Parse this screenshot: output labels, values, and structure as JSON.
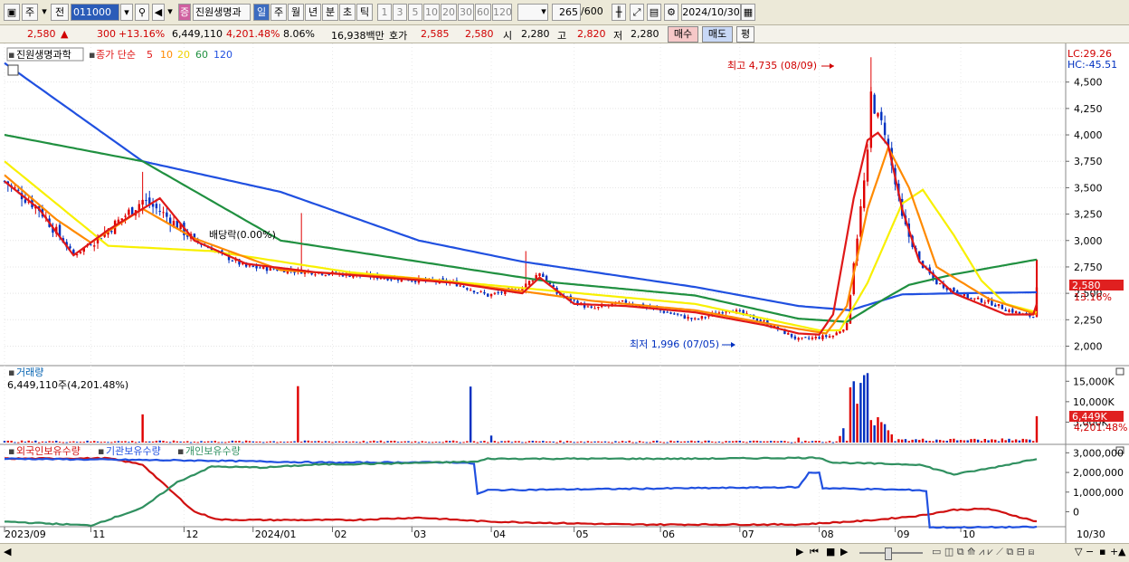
{
  "toolbar": {
    "market_sel": "주",
    "prev_label": "전",
    "stock_code": "011000",
    "stock_name": "진원생명과",
    "period_tabs": [
      "일",
      "주",
      "월",
      "년",
      "분",
      "초",
      "틱"
    ],
    "period_numbers": [
      "1",
      "3",
      "5",
      "10",
      "20",
      "30",
      "60",
      "120"
    ],
    "count": "265",
    "count_max": "/600",
    "date": "2024/10/30"
  },
  "quote": {
    "price": "2,580",
    "change_arrow": "▲",
    "change": "300",
    "change_pct": "+13.16%",
    "volume": "6,449,110",
    "vol_ratio": "4,201.48%",
    "turnover": "8.06%",
    "amount": "16,938백만",
    "hoga_label": "호가",
    "ask": "2,585",
    "bid": "2,580",
    "open_label": "시",
    "open": "2,280",
    "high_label": "고",
    "high": "2,820",
    "low_label": "저",
    "low": "2,280",
    "buy_label": "매수",
    "sell_label": "매도",
    "extra_label": "평"
  },
  "colors": {
    "ma5": "#e01818",
    "ma10": "#ff8a00",
    "ma20": "#f8f000",
    "ma60": "#209040",
    "ma120": "#2050e0",
    "up": "#e00000",
    "down": "#0030c0"
  },
  "chart_data": [
    {
      "type": "line",
      "panel": "price",
      "title": "진원생명과학",
      "legend": [
        "종가 단순",
        "5",
        "10",
        "20",
        "60",
        "120"
      ],
      "indicators": {
        "lc": "LC:29.26",
        "hc": "HC:-45.51"
      },
      "y_ticks": [
        "4,500",
        "4,250",
        "4,000",
        "3,750",
        "3,500",
        "3,250",
        "3,000",
        "2,750",
        "2,500",
        "2,250",
        "2,000"
      ],
      "ylim": [
        1850,
        4780
      ],
      "x_ticks": [
        "2023/09",
        "11",
        "12",
        "2024/01",
        "02",
        "03",
        "04",
        "05",
        "06",
        "07",
        "08",
        "09",
        "10",
        "10/30"
      ],
      "annotations": {
        "high": "최고 4,735 (08/09)",
        "low": "최저 1,996 (07/05)",
        "dividend": "배당락(0.00%)"
      },
      "last_price_label": "2,580",
      "last_change_label": "13.16%",
      "series": [
        {
          "name": "5",
          "anchors": [
            [
              0,
              3560
            ],
            [
              10,
              3300
            ],
            [
              20,
              2860
            ],
            [
              30,
              3100
            ],
            [
              45,
              3400
            ],
            [
              55,
              3000
            ],
            [
              70,
              2780
            ],
            [
              90,
              2700
            ],
            [
              110,
              2650
            ],
            [
              130,
              2600
            ],
            [
              150,
              2500
            ],
            [
              155,
              2650
            ],
            [
              165,
              2400
            ],
            [
              180,
              2380
            ],
            [
              200,
              2320
            ],
            [
              220,
              2200
            ],
            [
              230,
              2120
            ],
            [
              236,
              2110
            ],
            [
              240,
              2300
            ],
            [
              246,
              3400
            ],
            [
              250,
              3950
            ],
            [
              253,
              4020
            ],
            [
              256,
              3900
            ],
            [
              260,
              3300
            ],
            [
              265,
              2800
            ],
            [
              275,
              2500
            ],
            [
              290,
              2300
            ],
            [
              298,
              2300
            ],
            [
              299,
              2400
            ]
          ]
        },
        {
          "name": "10",
          "anchors": [
            [
              0,
              3620
            ],
            [
              15,
              3200
            ],
            [
              25,
              2980
            ],
            [
              40,
              3300
            ],
            [
              55,
              3020
            ],
            [
              80,
              2720
            ],
            [
              120,
              2640
            ],
            [
              150,
              2520
            ],
            [
              170,
              2430
            ],
            [
              200,
              2340
            ],
            [
              225,
              2190
            ],
            [
              238,
              2120
            ],
            [
              244,
              2380
            ],
            [
              250,
              3300
            ],
            [
              256,
              3880
            ],
            [
              262,
              3500
            ],
            [
              270,
              2750
            ],
            [
              285,
              2450
            ],
            [
              299,
              2300
            ]
          ]
        },
        {
          "name": "20",
          "anchors": [
            [
              0,
              3750
            ],
            [
              30,
              2950
            ],
            [
              60,
              2900
            ],
            [
              100,
              2700
            ],
            [
              150,
              2550
            ],
            [
              200,
              2400
            ],
            [
              236,
              2150
            ],
            [
              242,
              2150
            ],
            [
              250,
              2600
            ],
            [
              260,
              3350
            ],
            [
              266,
              3480
            ],
            [
              275,
              3050
            ],
            [
              283,
              2620
            ],
            [
              290,
              2400
            ],
            [
              299,
              2320
            ]
          ]
        },
        {
          "name": "60",
          "anchors": [
            [
              0,
              4000
            ],
            [
              40,
              3750
            ],
            [
              80,
              3000
            ],
            [
              120,
              2800
            ],
            [
              160,
              2600
            ],
            [
              200,
              2480
            ],
            [
              230,
              2260
            ],
            [
              244,
              2230
            ],
            [
              255,
              2450
            ],
            [
              262,
              2580
            ],
            [
              275,
              2680
            ],
            [
              299,
              2820
            ]
          ]
        },
        {
          "name": "120",
          "anchors": [
            [
              0,
              4680
            ],
            [
              40,
              3750
            ],
            [
              80,
              3460
            ],
            [
              120,
              3000
            ],
            [
              150,
              2800
            ],
            [
              200,
              2560
            ],
            [
              230,
              2380
            ],
            [
              245,
              2340
            ],
            [
              260,
              2490
            ],
            [
              275,
              2500
            ],
            [
              299,
              2510
            ]
          ]
        }
      ],
      "candle_path": [
        [
          0,
          3560
        ],
        [
          10,
          3300
        ],
        [
          20,
          2860
        ],
        [
          30,
          3100
        ],
        [
          40,
          3380
        ],
        [
          45,
          3280
        ],
        [
          55,
          3000
        ],
        [
          70,
          2750
        ],
        [
          90,
          2700
        ],
        [
          110,
          2650
        ],
        [
          130,
          2600
        ],
        [
          140,
          2480
        ],
        [
          150,
          2550
        ],
        [
          155,
          2700
        ],
        [
          160,
          2500
        ],
        [
          170,
          2350
        ],
        [
          180,
          2420
        ],
        [
          200,
          2250
        ],
        [
          210,
          2350
        ],
        [
          220,
          2230
        ],
        [
          230,
          2060
        ],
        [
          240,
          2100
        ],
        [
          244,
          2200
        ],
        [
          246,
          2800
        ],
        [
          248,
          3300
        ],
        [
          250,
          3800
        ],
        [
          251,
          4380
        ],
        [
          253,
          4150
        ],
        [
          255,
          4050
        ],
        [
          257,
          3700
        ],
        [
          260,
          3200
        ],
        [
          265,
          2800
        ],
        [
          270,
          2600
        ],
        [
          280,
          2450
        ],
        [
          285,
          2420
        ],
        [
          290,
          2350
        ],
        [
          295,
          2300
        ],
        [
          298,
          2280
        ],
        [
          299,
          2580
        ]
      ]
    },
    {
      "type": "bar",
      "panel": "volume",
      "title": "거래량",
      "subtitle": "6,449,110주(4,201.48%)",
      "y_ticks": [
        "15,000K",
        "10,000K",
        "5,000K"
      ],
      "ylim": [
        0,
        17500
      ],
      "last_label": "6,449K",
      "last_pct": "4,201.48%",
      "spikes": [
        [
          40,
          6900
        ],
        [
          85,
          13800
        ],
        [
          135,
          13700
        ],
        [
          141,
          1700
        ],
        [
          230,
          1200
        ],
        [
          242,
          1600
        ],
        [
          243,
          3500
        ],
        [
          245,
          13500
        ],
        [
          246,
          15000
        ],
        [
          247,
          9500
        ],
        [
          248,
          14600
        ],
        [
          249,
          16500
        ],
        [
          250,
          17000
        ],
        [
          251,
          5500
        ],
        [
          252,
          4200
        ],
        [
          253,
          6200
        ],
        [
          254,
          5000
        ],
        [
          255,
          4500
        ],
        [
          256,
          3000
        ],
        [
          257,
          2000
        ],
        [
          299,
          6449
        ]
      ]
    },
    {
      "type": "line",
      "panel": "holdings",
      "legend": [
        "외국인보유수량",
        "기관보유수량",
        "개인보유수량"
      ],
      "y_ticks": [
        "3,000,000",
        "2,000,000",
        "1,000,000",
        "0"
      ],
      "ylim": [
        -900000,
        3200000
      ],
      "series": [
        {
          "name": "외국인보유수량",
          "color": "#d01010",
          "anchors": [
            [
              0,
              2700000
            ],
            [
              30,
              2720000
            ],
            [
              40,
              2400000
            ],
            [
              48,
              1100000
            ],
            [
              55,
              0
            ],
            [
              62,
              -400000
            ],
            [
              75,
              -420000
            ],
            [
              100,
              -420000
            ],
            [
              120,
              -300000
            ],
            [
              140,
              -500000
            ],
            [
              180,
              -650000
            ],
            [
              230,
              -650000
            ],
            [
              250,
              -450000
            ],
            [
              265,
              -200000
            ],
            [
              275,
              100000
            ],
            [
              285,
              150000
            ],
            [
              299,
              -500000
            ]
          ]
        },
        {
          "name": "기관보유수량",
          "color": "#2050e0",
          "anchors": [
            [
              0,
              2700000
            ],
            [
              60,
              2600000
            ],
            [
              95,
              2500000
            ],
            [
              130,
              2520000
            ],
            [
              136,
              2450000
            ],
            [
              137,
              900000
            ],
            [
              140,
              1100000
            ],
            [
              200,
              1200000
            ],
            [
              230,
              1250000
            ],
            [
              233,
              1980000
            ],
            [
              236,
              2000000
            ],
            [
              237,
              1200000
            ],
            [
              265,
              1100000
            ],
            [
              267,
              1050000
            ],
            [
              268,
              -800000
            ],
            [
              299,
              -780000
            ]
          ]
        },
        {
          "name": "개인보유수량",
          "color": "#309060",
          "anchors": [
            [
              0,
              -500000
            ],
            [
              25,
              -700000
            ],
            [
              40,
              200000
            ],
            [
              50,
              1500000
            ],
            [
              60,
              2300000
            ],
            [
              75,
              2250000
            ],
            [
              90,
              2400000
            ],
            [
              110,
              2450000
            ],
            [
              137,
              2550000
            ],
            [
              140,
              2700000
            ],
            [
              200,
              2700000
            ],
            [
              236,
              2750000
            ],
            [
              240,
              2500000
            ],
            [
              265,
              2400000
            ],
            [
              275,
              1900000
            ],
            [
              285,
              2200000
            ],
            [
              299,
              2700000
            ]
          ]
        }
      ]
    }
  ]
}
